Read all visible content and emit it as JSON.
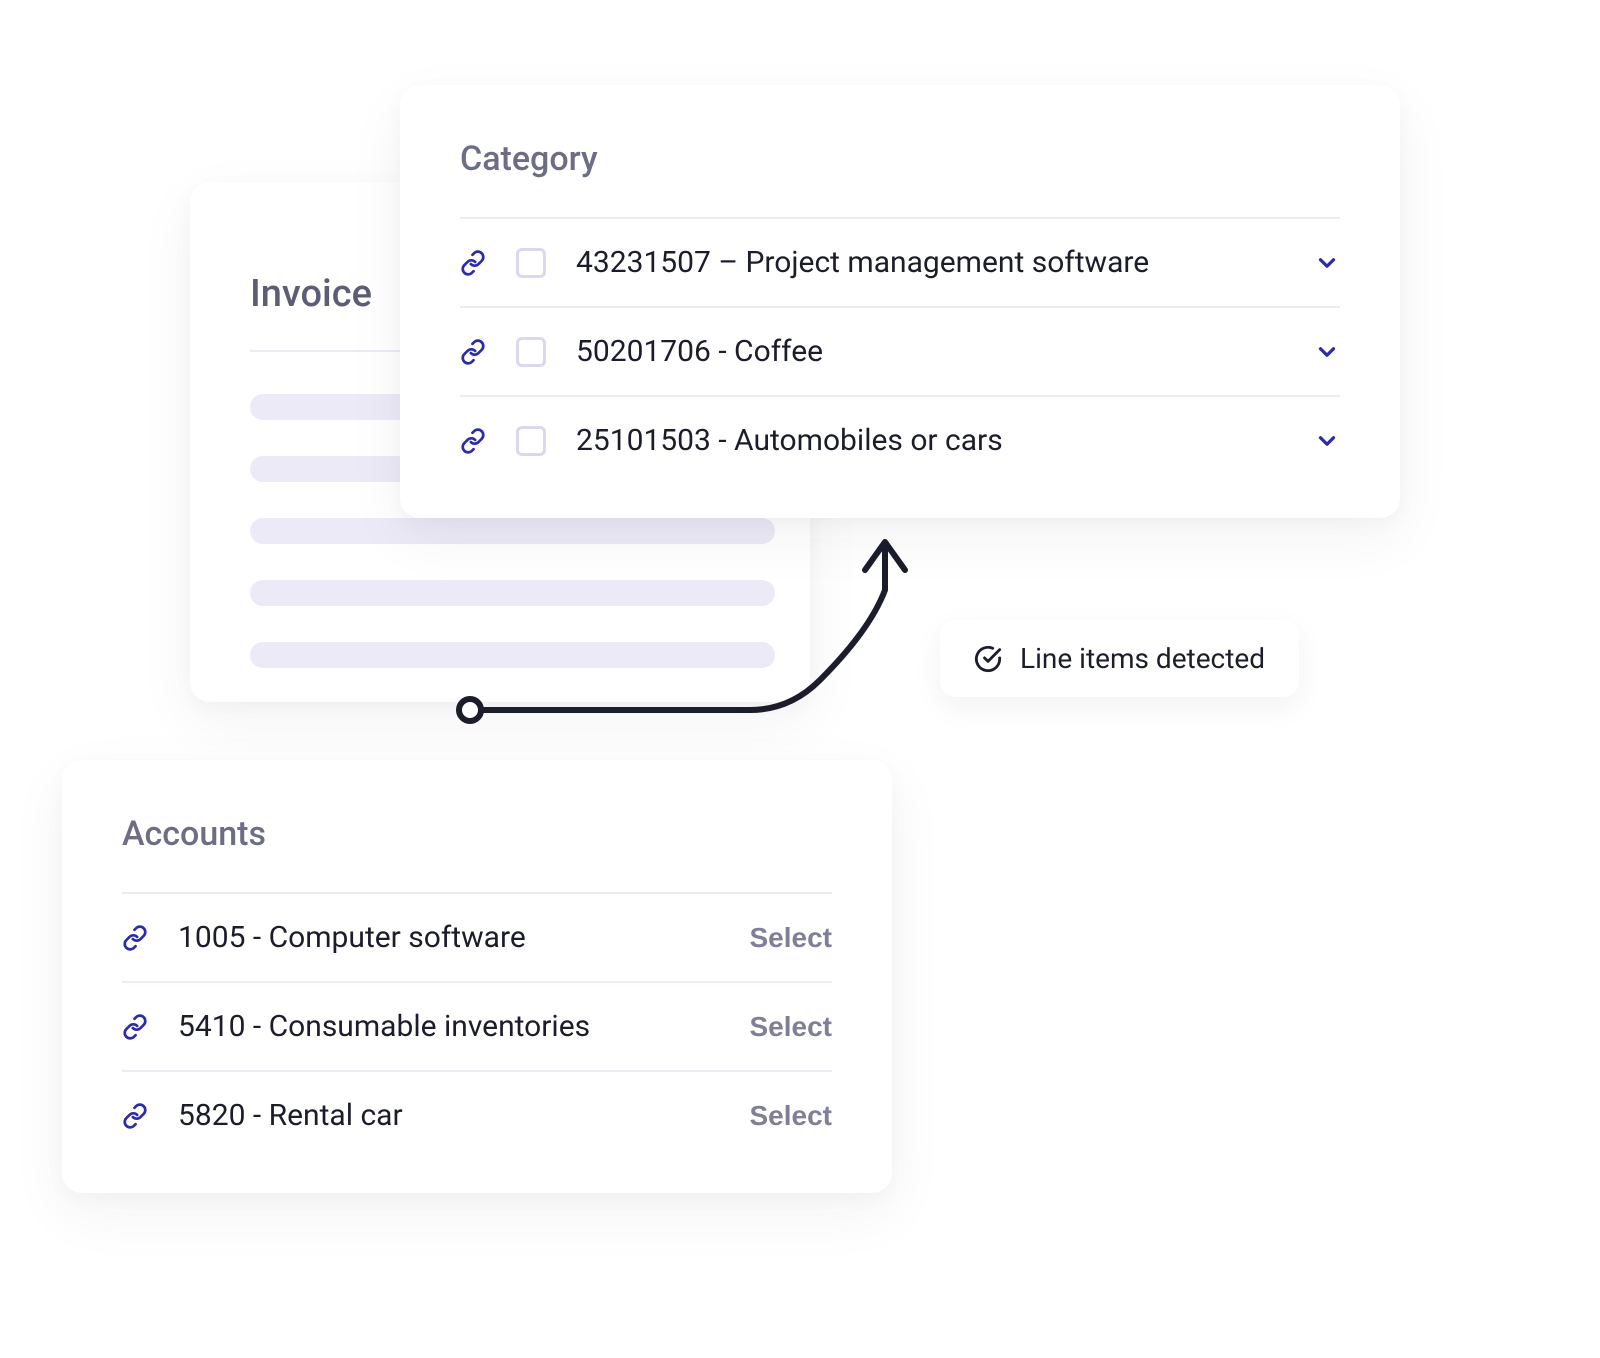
{
  "invoice": {
    "title": "Invoice"
  },
  "category": {
    "heading": "Category",
    "rows": [
      {
        "label": "43231507 – Project management software"
      },
      {
        "label": "50201706 - Coffee"
      },
      {
        "label": "25101503 - Automobiles or cars"
      }
    ]
  },
  "accounts": {
    "heading": "Accounts",
    "select_label": "Select",
    "rows": [
      {
        "label": "1005 - Computer software"
      },
      {
        "label": "5410 - Consumable inventories"
      },
      {
        "label": "5820 - Rental car"
      }
    ]
  },
  "detected": {
    "label": "Line items detected"
  }
}
